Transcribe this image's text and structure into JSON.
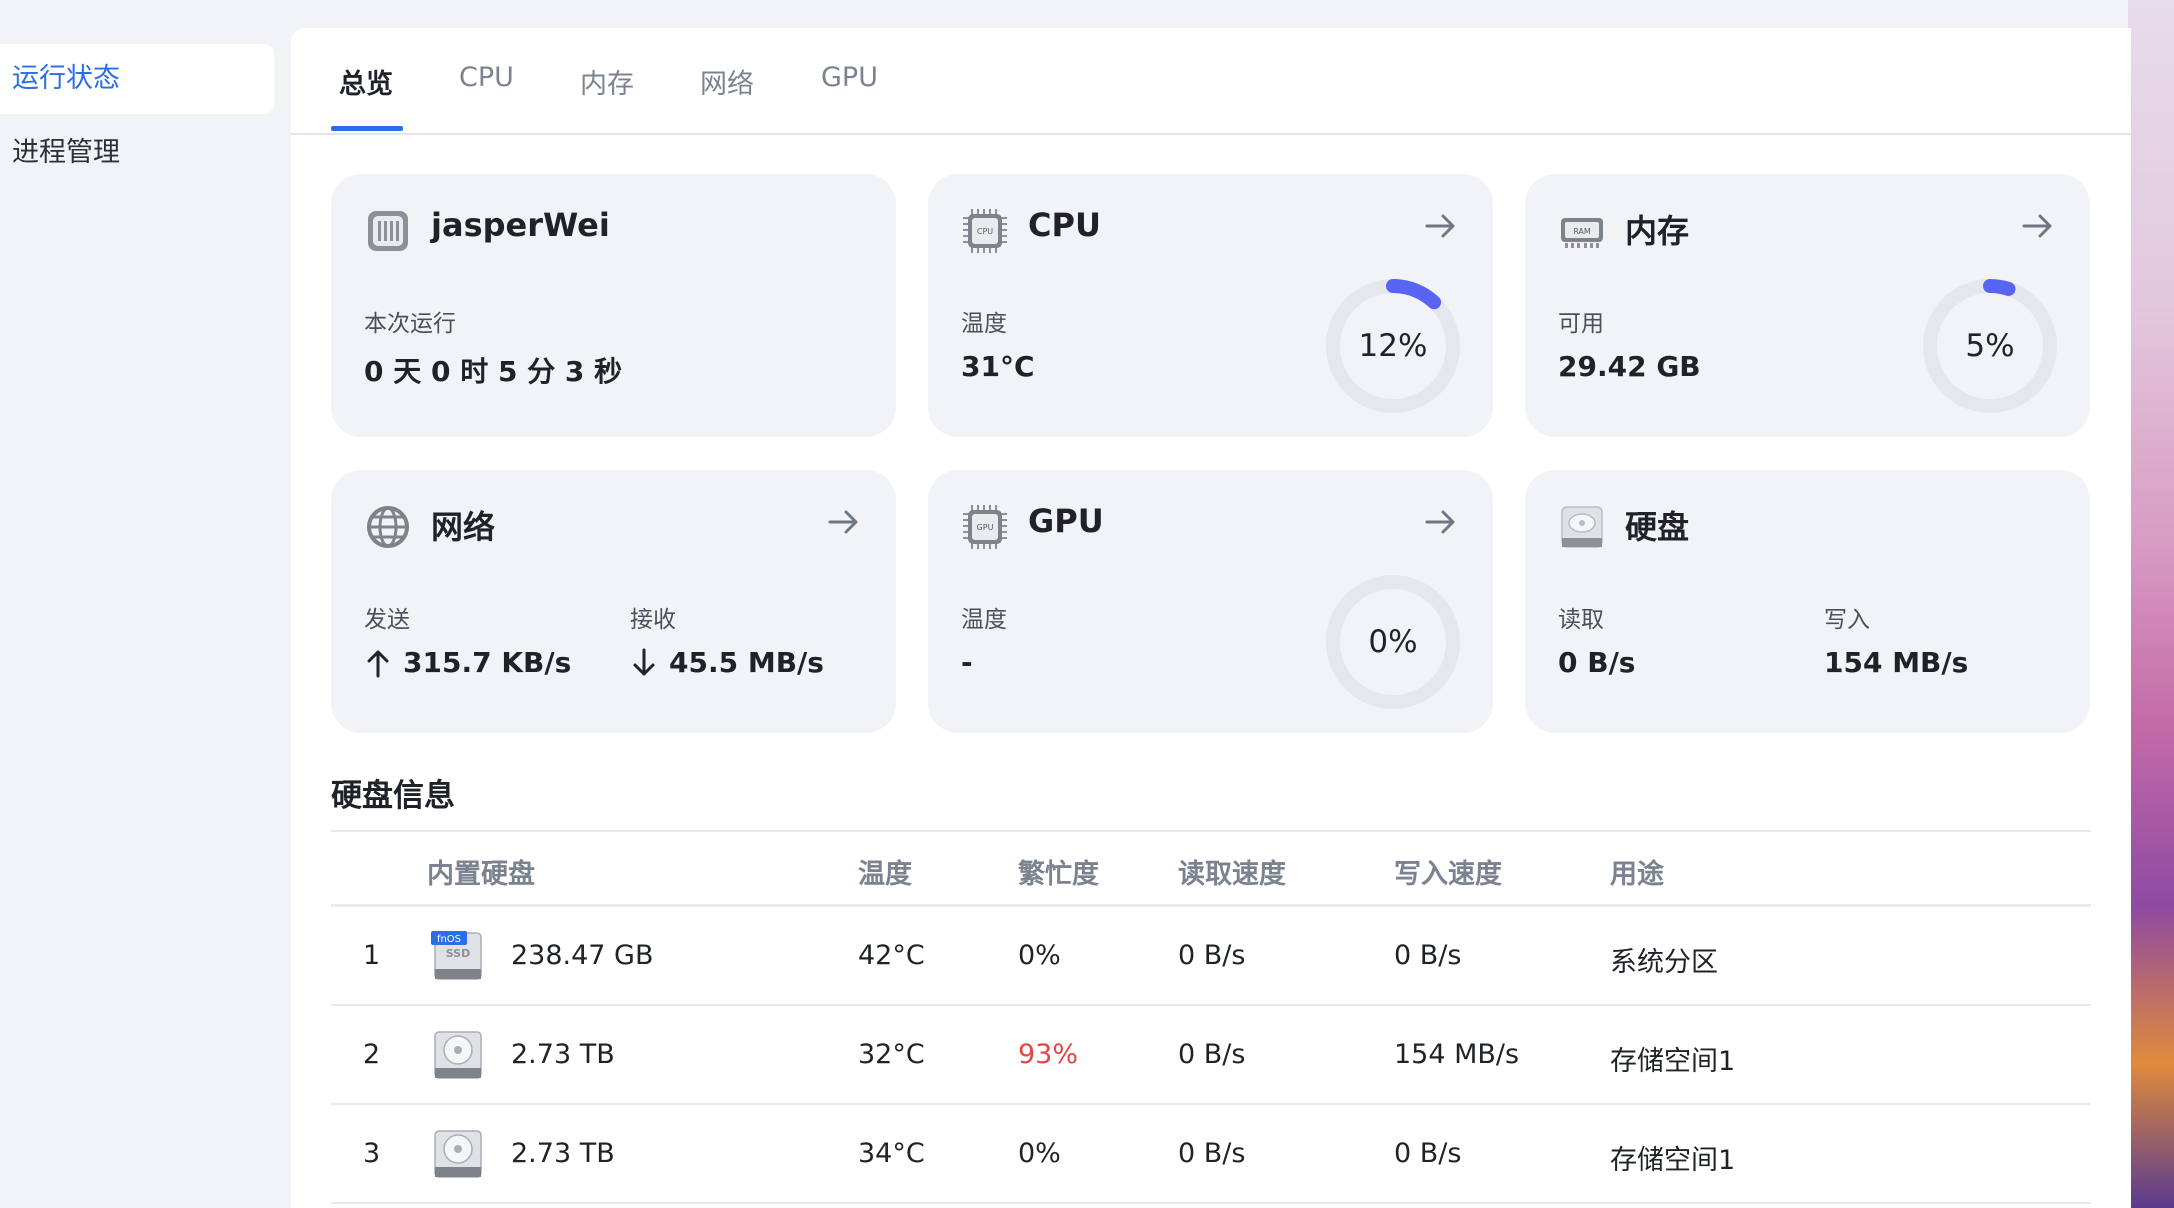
{
  "sidebar": {
    "items": [
      {
        "label": "运行状态",
        "active": true
      },
      {
        "label": "进程管理",
        "active": false
      }
    ]
  },
  "tabs": [
    {
      "label": "总览",
      "active": true
    },
    {
      "label": "CPU",
      "active": false
    },
    {
      "label": "内存",
      "active": false
    },
    {
      "label": "网络",
      "active": false
    },
    {
      "label": "GPU",
      "active": false
    }
  ],
  "cards": {
    "device": {
      "icon": "server-icon",
      "title": "jasperWei",
      "uptime_label": "本次运行",
      "uptime_value": "0 天 0 时 5 分 3 秒"
    },
    "cpu": {
      "icon": "cpu-chip-icon",
      "title": "CPU",
      "temp_label": "温度",
      "temp_value": "31°C",
      "usage_text": "12%",
      "usage": 0.12,
      "accent": "#5865f2"
    },
    "memory": {
      "icon": "ram-icon",
      "title": "内存",
      "avail_label": "可用",
      "avail_value": "29.42 GB",
      "usage_text": "5%",
      "usage": 0.05,
      "accent": "#5865f2"
    },
    "network": {
      "icon": "globe-icon",
      "title": "网络",
      "send_label": "发送",
      "send_value": "315.7 KB/s",
      "recv_label": "接收",
      "recv_value": "45.5 MB/s"
    },
    "gpu": {
      "icon": "gpu-chip-icon",
      "title": "GPU",
      "temp_label": "温度",
      "temp_value": "-",
      "usage_text": "0%",
      "usage": 0.0
    },
    "disk": {
      "icon": "hard-disk-icon",
      "title": "硬盘",
      "read_label": "读取",
      "read_value": "0 B/s",
      "write_label": "写入",
      "write_value": "154 MB/s"
    }
  },
  "disk_info": {
    "title": "硬盘信息",
    "columns": [
      "内置硬盘",
      "温度",
      "繁忙度",
      "读取速度",
      "写入速度",
      "用途"
    ],
    "rows": [
      {
        "index": "1",
        "icon": "ssd-icon",
        "badge": "fnOS",
        "badge2": "SSD",
        "size": "238.47 GB",
        "temp": "42°C",
        "busy": "0%",
        "read": "0 B/s",
        "write": "0 B/s",
        "usage": "系统分区",
        "hot": false
      },
      {
        "index": "2",
        "icon": "hdd-icon",
        "size": "2.73 TB",
        "temp": "32°C",
        "busy": "93%",
        "read": "0 B/s",
        "write": "154 MB/s",
        "usage": "存储空间1",
        "hot": true
      },
      {
        "index": "3",
        "icon": "hdd-icon",
        "size": "2.73 TB",
        "temp": "34°C",
        "busy": "0%",
        "read": "0 B/s",
        "write": "0 B/s",
        "usage": "存储空间1",
        "hot": false
      }
    ],
    "hot_color": "#e54545"
  }
}
